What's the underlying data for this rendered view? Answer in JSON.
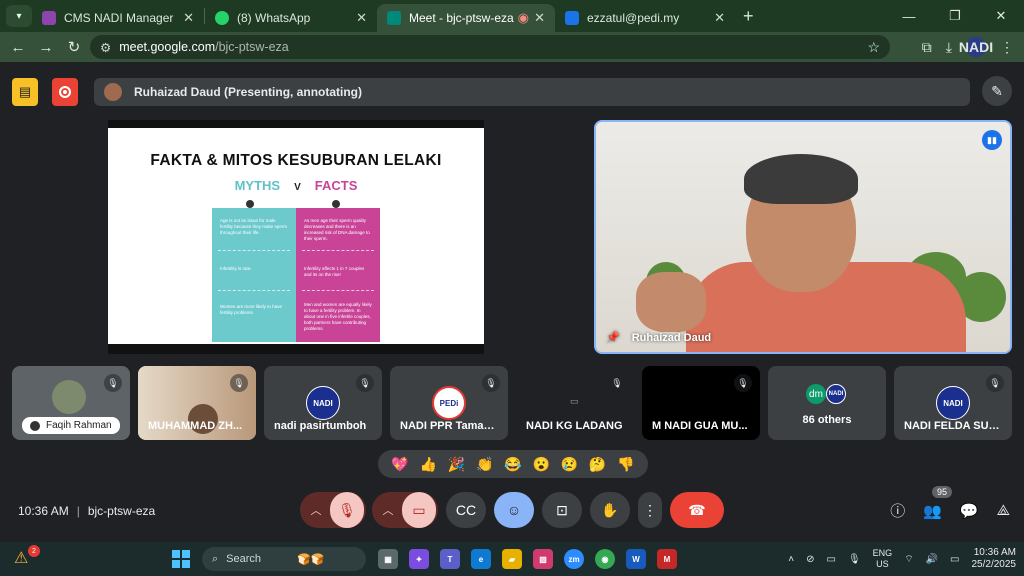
{
  "browser": {
    "tabs": [
      {
        "label": "CMS NADI Manager",
        "color": "#8e44ad"
      },
      {
        "label": "(8) WhatsApp",
        "color": "#25d366"
      },
      {
        "label": "Meet - bjc-ptsw-eza",
        "color": "#00897b"
      },
      {
        "label": "ezzatul@pedi.my",
        "color": "#1a73e8"
      }
    ],
    "url_site": "meet.google.com",
    "url_path": "/bjc-ptsw-eza",
    "profile_label": "NADI"
  },
  "meet": {
    "presenter_bar": "Ruhaizad Daud (Presenting, annotating)",
    "slide": {
      "title": "FAKTA & MITOS KESUBURAN LELAKI",
      "myths": "MYTHS",
      "v": "V",
      "facts": "FACTS",
      "myth_rows": [
        "Age is not an issue for male fertility because they make sperm throughout their life.",
        "Infertility is rare.",
        "Women are more likely to have fertility problems."
      ],
      "fact_rows": [
        "As men age their sperm quality decreases and there is an increased risk of DNA damage to their sperm.",
        "Infertility affects 1 in 7 couples and its on the rise!",
        "Men and women are equally likely to have a fertility problem. In about one in five infertile couples, both partners have contributing problems."
      ]
    },
    "speaker": {
      "name": "Ruhaizad Daud",
      "audio_icon": "audio-bars-icon"
    },
    "participants": [
      {
        "name": "Faqih Rahman"
      },
      {
        "name": "MUHAMMAD ZH..."
      },
      {
        "name": "nadi pasirtumboh",
        "logo": "NADI"
      },
      {
        "name": "NADI PPR Taman ...",
        "logo": "PEDi"
      },
      {
        "name": "NADI KG LADANG"
      },
      {
        "name": "M NADI GUA MU..."
      },
      {
        "name": "86 others",
        "chip1": "dm",
        "chip2": "NADI"
      },
      {
        "name": "NADI FELDA SUN...",
        "logo": "NADI"
      }
    ],
    "reactions": [
      "💖",
      "👍",
      "🎉",
      "👏",
      "😂",
      "😮",
      "😢",
      "🤔",
      "👎"
    ],
    "time": "10:36 AM",
    "meeting_code": "bjc-ptsw-eza",
    "people_count": "95"
  },
  "taskbar": {
    "search_placeholder": "Search",
    "widget_badge": "2",
    "lang_line1": "ENG",
    "lang_line2": "US",
    "clock_time": "10:36 AM",
    "clock_date": "25/2/2025",
    "apps": [
      {
        "label": "▦",
        "color": "#5a6a6a"
      },
      {
        "label": "✦",
        "color": "#7b4ce0"
      },
      {
        "label": "T",
        "color": "#5b5fc7"
      },
      {
        "label": "e",
        "color": "#0f7ad1"
      },
      {
        "label": "▰",
        "color": "#e8b100"
      },
      {
        "label": "▧",
        "color": "#d13a6f"
      },
      {
        "label": "zm",
        "color": "#2d8cff"
      },
      {
        "label": "◉",
        "color": "#34a853"
      },
      {
        "label": "W",
        "color": "#185abd"
      },
      {
        "label": "M",
        "color": "#c62828"
      }
    ]
  }
}
